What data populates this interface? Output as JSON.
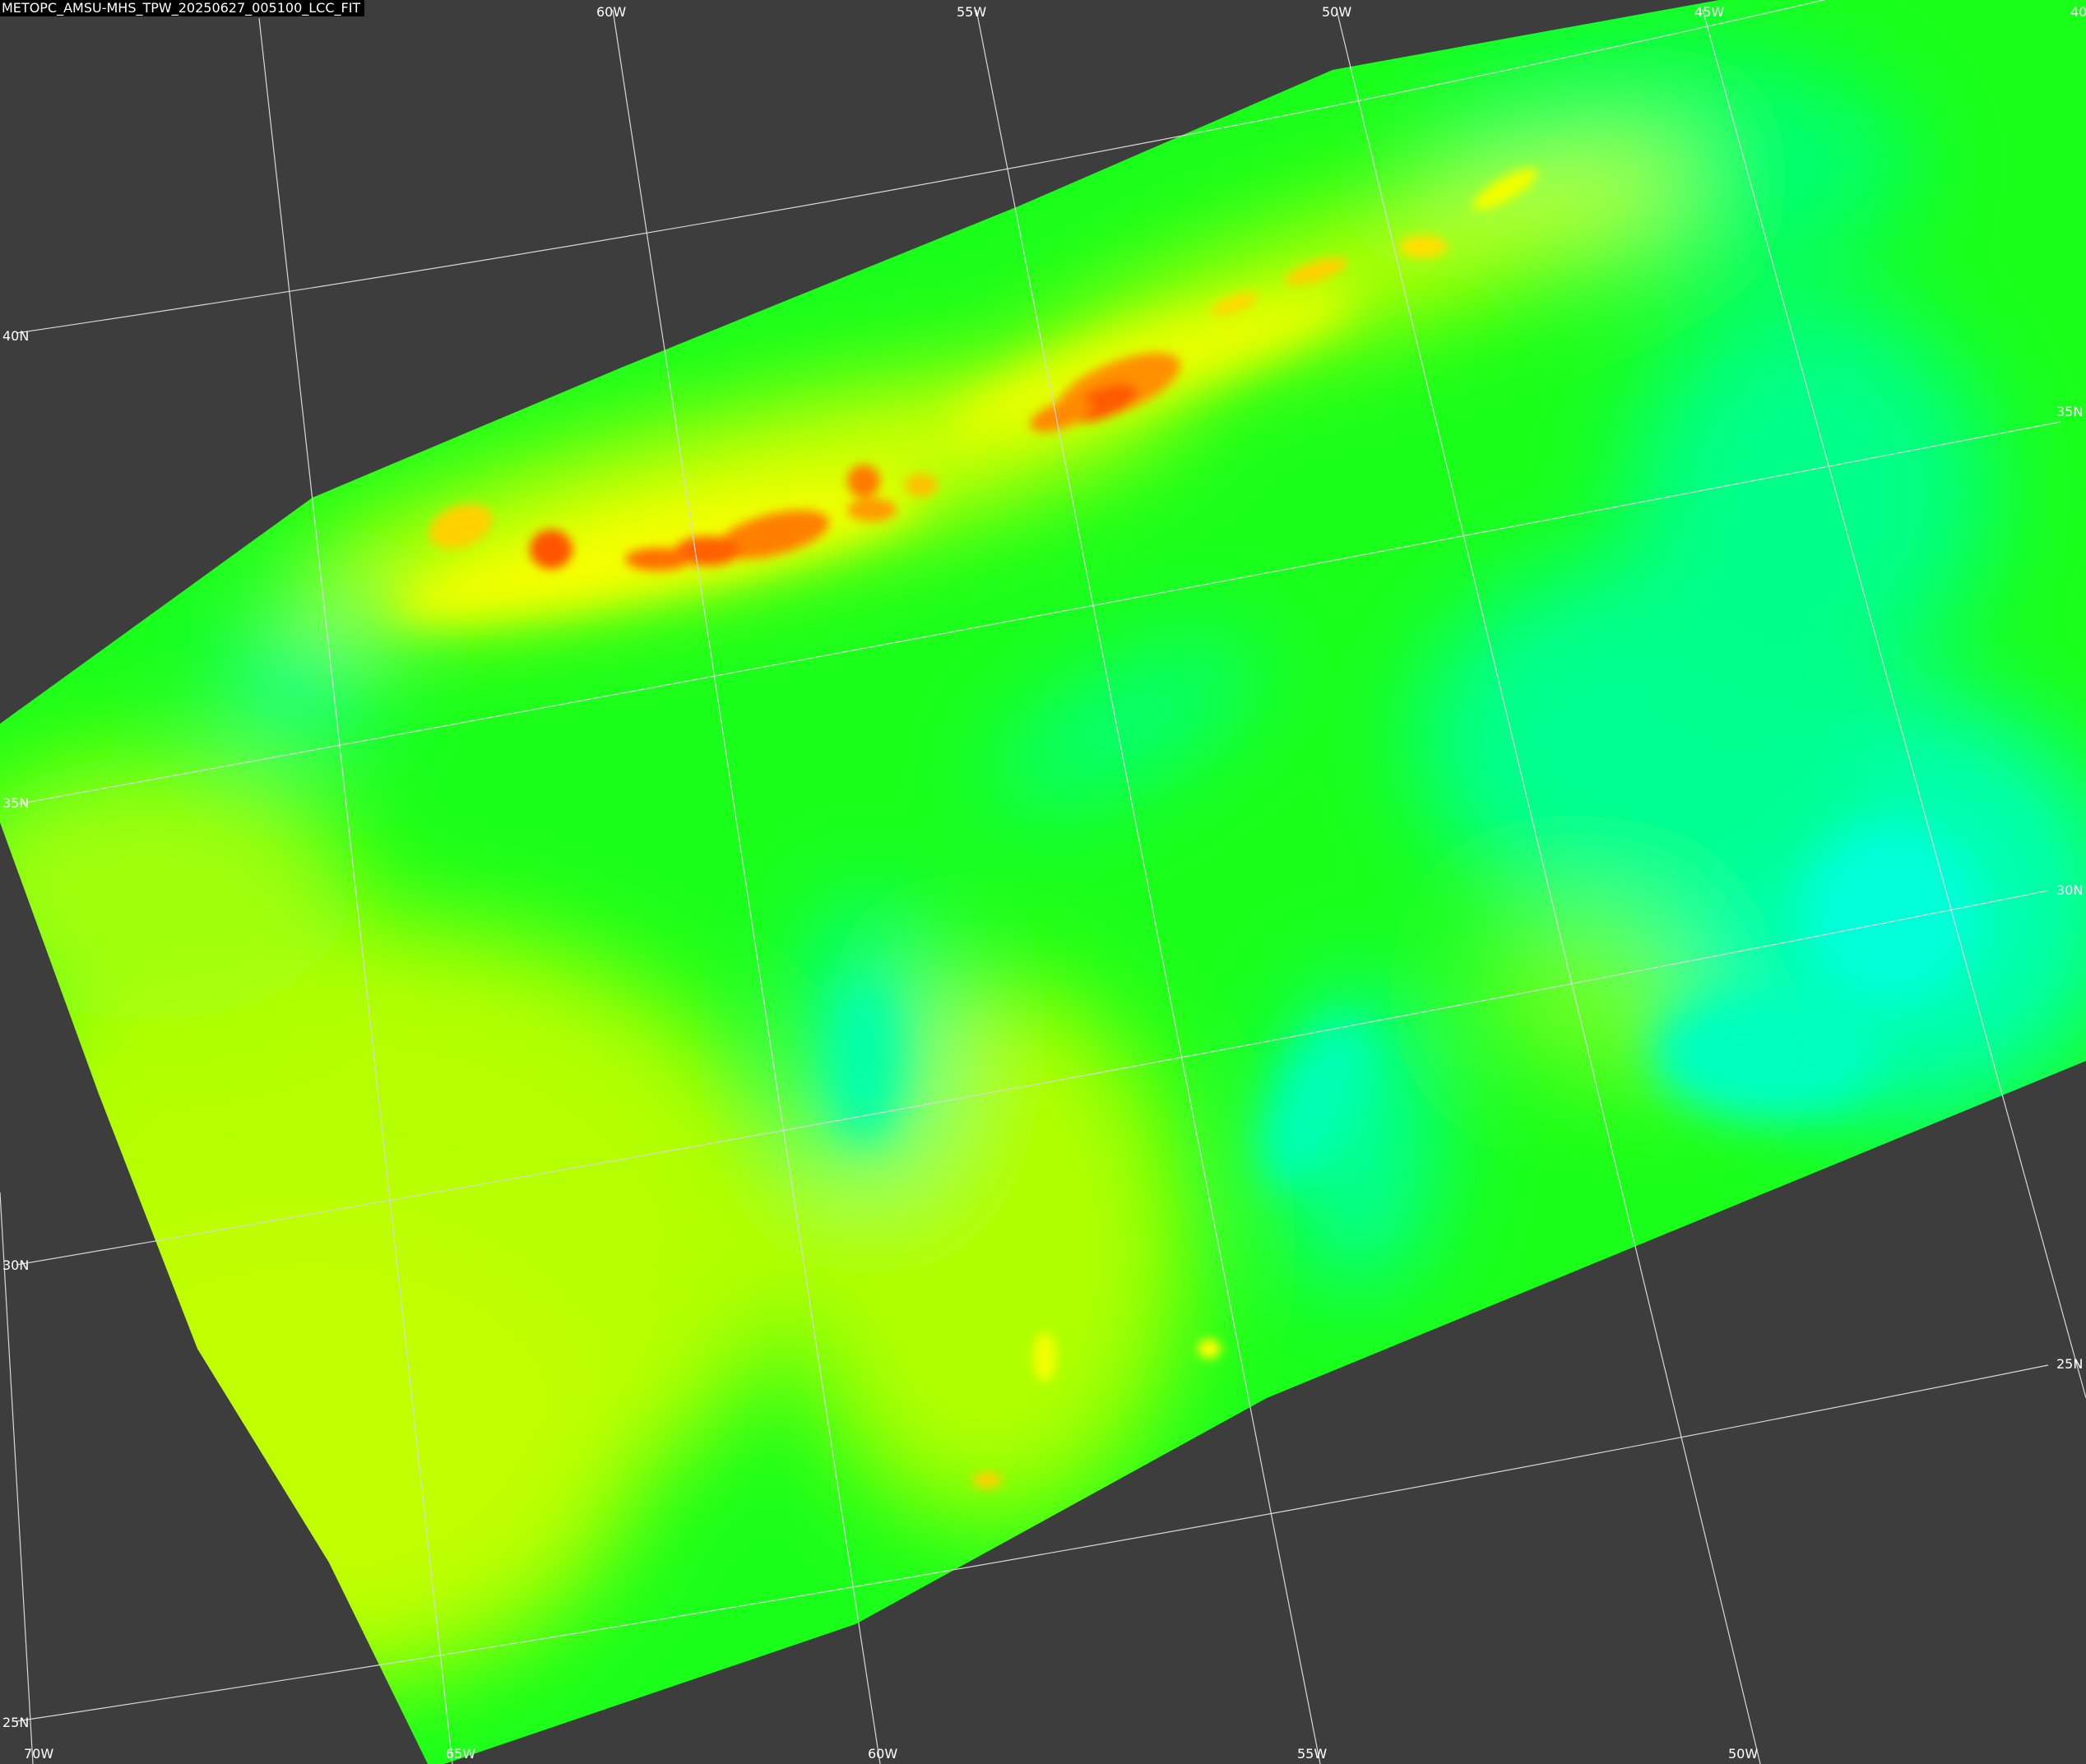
{
  "image_title": "METOPC_AMSU-MHS_TPW_20250627_005100_LCC_FIT",
  "colors": {
    "background": "#3d3d3d",
    "gridline": "#d8d8d8",
    "label": "#ffffff",
    "swath_low": "#00ff80",
    "swath_mid": "#00ff33",
    "swath_high": "#c8ff00",
    "moisture_max": "#ff6a00"
  },
  "graticule": {
    "longitude_labels": {
      "top": [
        "60W",
        "55W",
        "50W",
        "45W",
        "40"
      ],
      "bottom": [
        "70W",
        "65W",
        "60W",
        "55W",
        "50W"
      ]
    },
    "latitude_labels": {
      "left": [
        "40N",
        "35N",
        "30N",
        "25N"
      ],
      "right": [
        "35N",
        "30N",
        "25N"
      ]
    }
  }
}
